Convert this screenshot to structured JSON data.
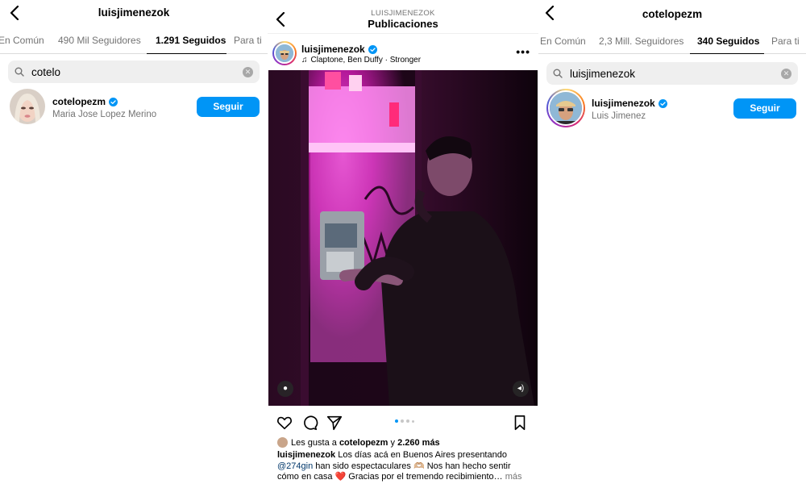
{
  "left": {
    "title": "luisjimenezok",
    "tabs": [
      "En Común",
      "490 Mil Seguidores",
      "1.291 Seguidos",
      "Para ti"
    ],
    "active_tab": 2,
    "search_query": "cotelo",
    "result": {
      "username": "cotelopezm",
      "full_name": "Maria Jose Lopez Merino",
      "follow_label": "Seguir"
    }
  },
  "middle": {
    "subtitle": "LUISJIMENEZOK",
    "title": "Publicaciones",
    "post": {
      "username": "luisjimenezok",
      "music": "Claptone, Ben Duffy · Stronger",
      "more": "•••",
      "carousel_count": 4,
      "carousel_active": 0,
      "likes_prefix": "Les gusta a",
      "likes_user": "cotelopezm",
      "likes_mid": "y",
      "likes_count": "2.260 más",
      "caption_user": "luisjimenezok",
      "caption_part1": "Los días acá en Buenos Aires presentando",
      "caption_mention": "@274gin",
      "caption_part2": "han sido espectaculares 🫶🏼 Nos han hecho sentir cómo en casa ❤️ Gracias por el tremendo recibimiento…",
      "caption_more": "más"
    }
  },
  "right": {
    "title": "cotelopezm",
    "tabs": [
      "En Común",
      "2,3 Mill. Seguidores",
      "340 Seguidos",
      "Para ti"
    ],
    "active_tab": 2,
    "search_query": "luisjimenezok",
    "result": {
      "username": "luisjimenezok",
      "full_name": "Luis Jimenez",
      "follow_label": "Seguir"
    }
  },
  "colors": {
    "accent": "#0095f6",
    "muted": "#737373",
    "neon": "#ff2bd0"
  }
}
